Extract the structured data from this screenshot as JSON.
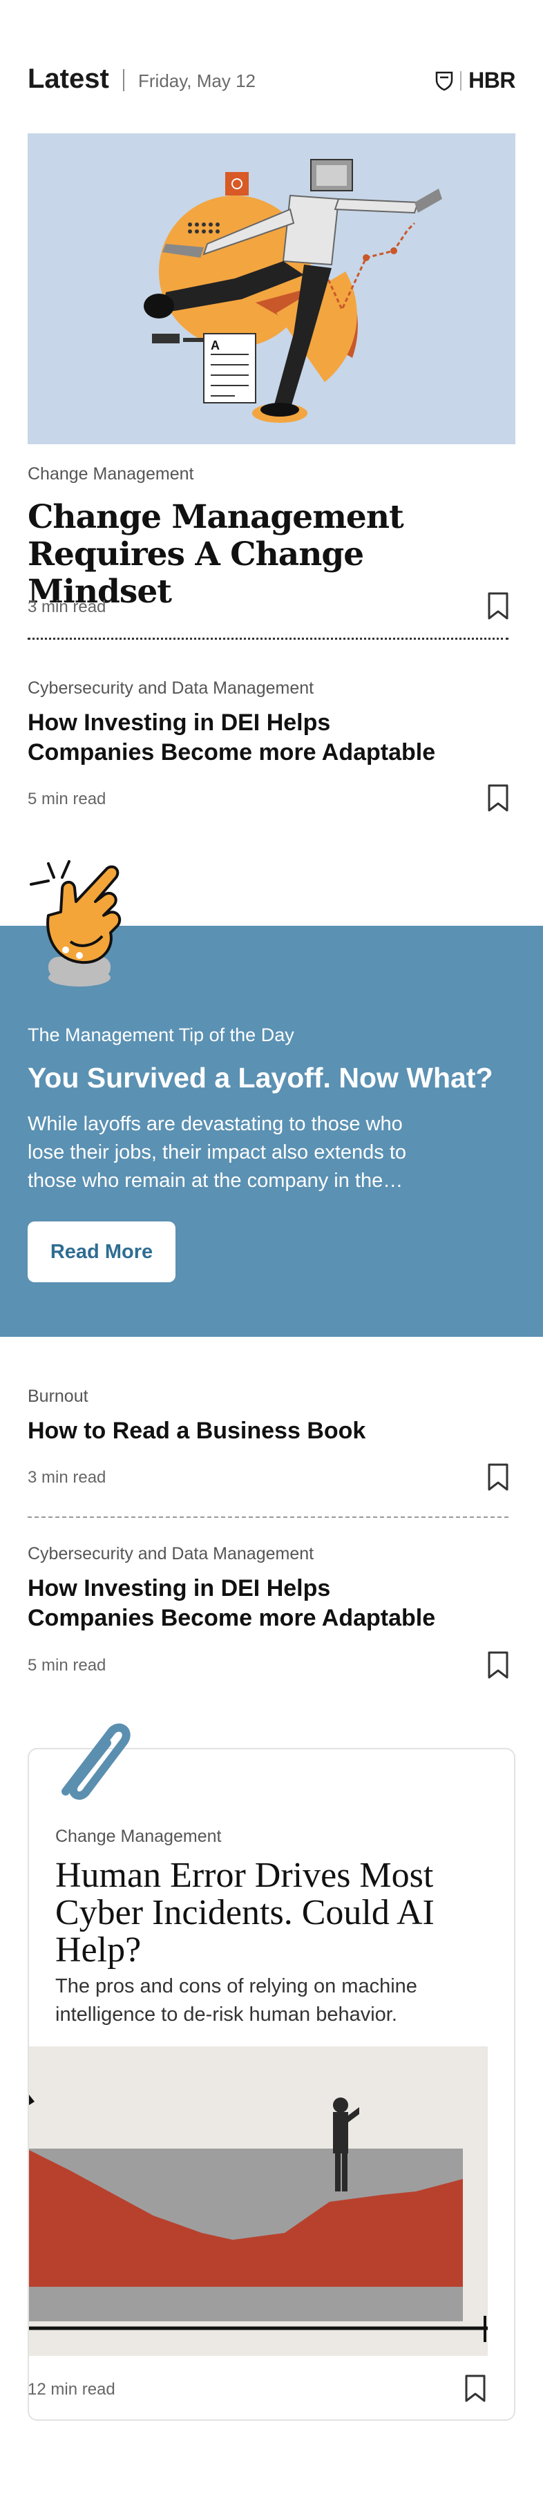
{
  "header": {
    "title": "Latest",
    "date": "Friday, May 12",
    "logo": "HBR"
  },
  "articles": [
    {
      "category": "Change Management",
      "title_line1": "Change Management",
      "title_line2": "Requires A Change Mindset",
      "read_time": "3 min read"
    },
    {
      "category": "Cybersecurity and Data Management",
      "title_line1": "How Investing in DEI Helps",
      "title_line2": "Companies Become more Adaptable",
      "read_time": "5 min read"
    },
    {
      "category": "Burnout",
      "title_line1": "How to Read a Business Book",
      "read_time": "3 min read"
    },
    {
      "category": "Cybersecurity and Data Management",
      "title_line1": "How Investing in DEI Helps",
      "title_line2": "Companies Become more Adaptable",
      "read_time": "5 min read"
    }
  ],
  "tip": {
    "label": "The Management Tip of the Day",
    "title": "You Survived a Layoff. Now What?",
    "body_line1": "While layoffs are devastating to those who",
    "body_line2": "lose their jobs, their impact also extends to",
    "body_line3": "those who remain at the company in the…",
    "button": "Read More"
  },
  "featured": {
    "category": "Change Management",
    "title_line1": "Human Error Drives Most",
    "title_line2": "Cyber Incidents. Could AI",
    "title_line3": "Help?",
    "desc_line1": "The pros and cons of relying on machine",
    "desc_line2": "intelligence to de-risk human behavior.",
    "read_time": "12 min read"
  },
  "colors": {
    "tip_bg": "#5b91b3",
    "hero_bg": "#c7d6e8",
    "accent_orange": "#f3a540",
    "accent_rust": "#c8582a",
    "chart_red": "#b8412e",
    "paperclip": "#5b8fb0"
  },
  "icons": {
    "bookmark": "bookmark-icon",
    "logo_shield": "hbr-shield-icon",
    "pointing_hand": "pointing-hand-icon",
    "paperclip": "paperclip-icon"
  }
}
